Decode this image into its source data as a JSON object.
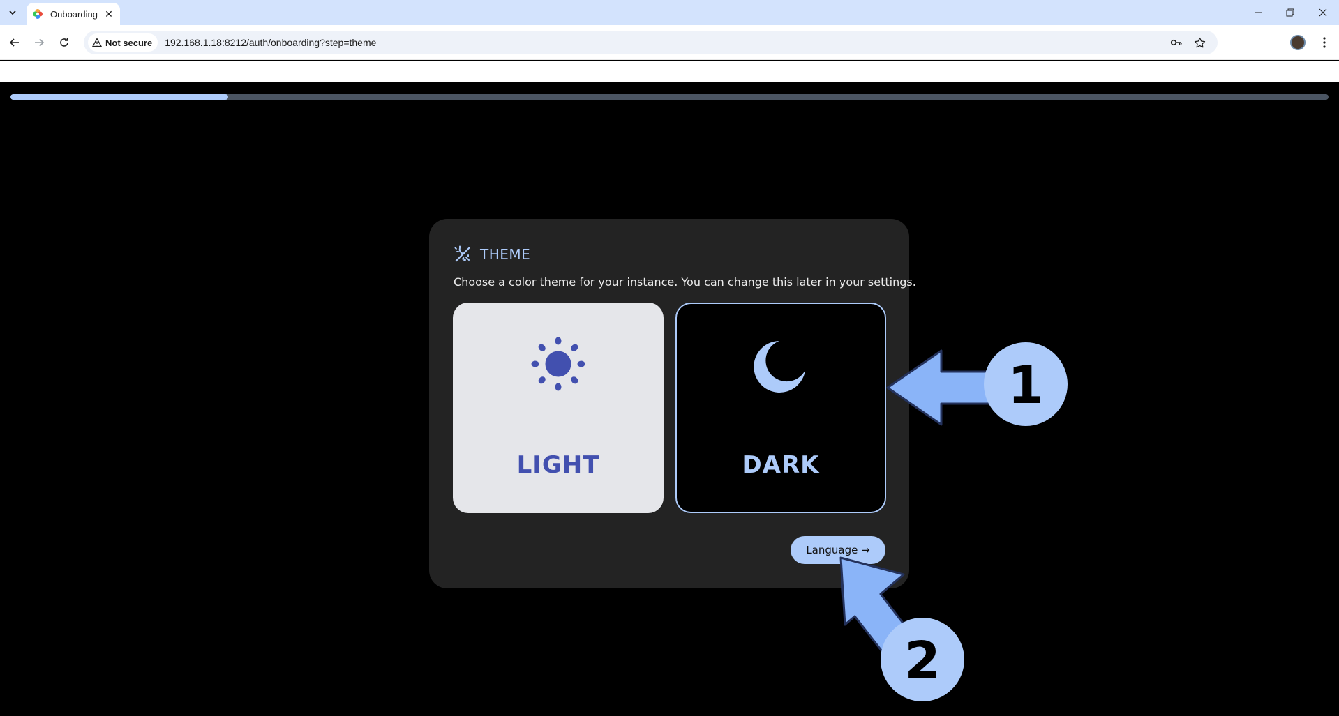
{
  "browser": {
    "tab_title": "Onboarding",
    "security_label": "Not secure",
    "url": "192.168.1.18:8212/auth/onboarding?step=theme"
  },
  "onboarding": {
    "progress_fraction": 0.165,
    "section_title": "THEME",
    "description": "Choose a color theme for your instance. You can change this later in your settings.",
    "options": [
      {
        "label": "LIGHT",
        "icon": "sun-icon",
        "selected": false
      },
      {
        "label": "DARK",
        "icon": "moon-icon",
        "selected": true
      }
    ],
    "next_button_label": "Language →"
  },
  "annotations": {
    "step_1": "1",
    "step_2": "2"
  },
  "colors": {
    "accent": "#adcbfa",
    "light_label": "#4250af",
    "card_bg": "#232323"
  }
}
